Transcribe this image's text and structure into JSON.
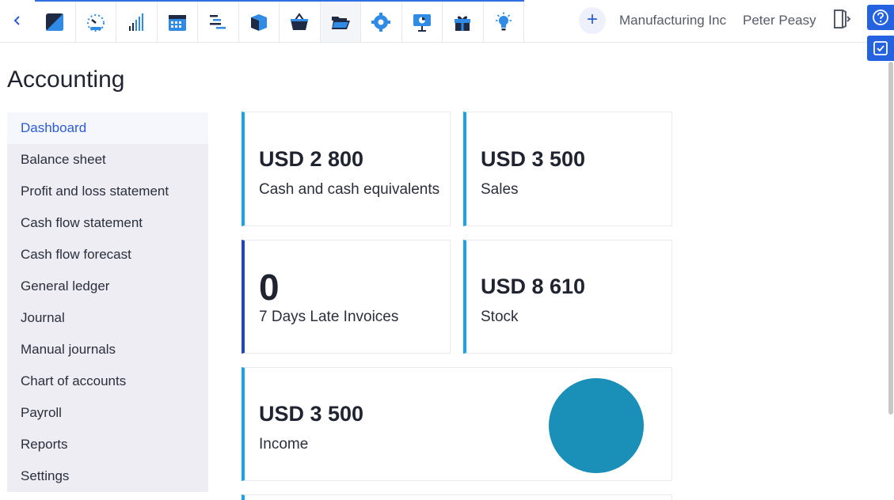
{
  "topbar": {
    "apps": [
      {
        "name": "logo-icon"
      },
      {
        "name": "speedometer-icon"
      },
      {
        "name": "signal-bars-icon"
      },
      {
        "name": "calendar-icon"
      },
      {
        "name": "gantt-icon"
      },
      {
        "name": "box-icon"
      },
      {
        "name": "basket-icon"
      },
      {
        "name": "folder-open-icon",
        "active": true
      },
      {
        "name": "gear-icon"
      },
      {
        "name": "presentation-icon"
      },
      {
        "name": "gift-icon"
      },
      {
        "name": "lightbulb-icon"
      }
    ],
    "add_label": "+",
    "company": "Manufacturing Inc",
    "user": "Peter Peasy"
  },
  "page": {
    "title": "Accounting"
  },
  "sidebar": {
    "items": [
      {
        "label": "Dashboard",
        "active": true
      },
      {
        "label": "Balance sheet"
      },
      {
        "label": "Profit and loss statement"
      },
      {
        "label": "Cash flow statement"
      },
      {
        "label": "Cash flow forecast"
      },
      {
        "label": "General ledger"
      },
      {
        "label": "Journal"
      },
      {
        "label": "Manual journals"
      },
      {
        "label": "Chart of accounts"
      },
      {
        "label": "Payroll"
      },
      {
        "label": "Reports"
      },
      {
        "label": "Settings"
      }
    ]
  },
  "cards": {
    "cash": {
      "value": "USD 2 800",
      "label": "Cash and cash equivalents"
    },
    "sales": {
      "value": "USD 3 500",
      "label": "Sales"
    },
    "late": {
      "value": "0",
      "label": "7 Days Late Invoices"
    },
    "stock": {
      "value": "USD 8 610",
      "label": "Stock"
    },
    "income": {
      "value": "USD 3 500",
      "label": "Income"
    }
  },
  "colors": {
    "accent": "#2f6fe4",
    "card_border": "#1aa3e8",
    "card_border_dark": "#2046c4",
    "pie": "#1a8fb8"
  }
}
